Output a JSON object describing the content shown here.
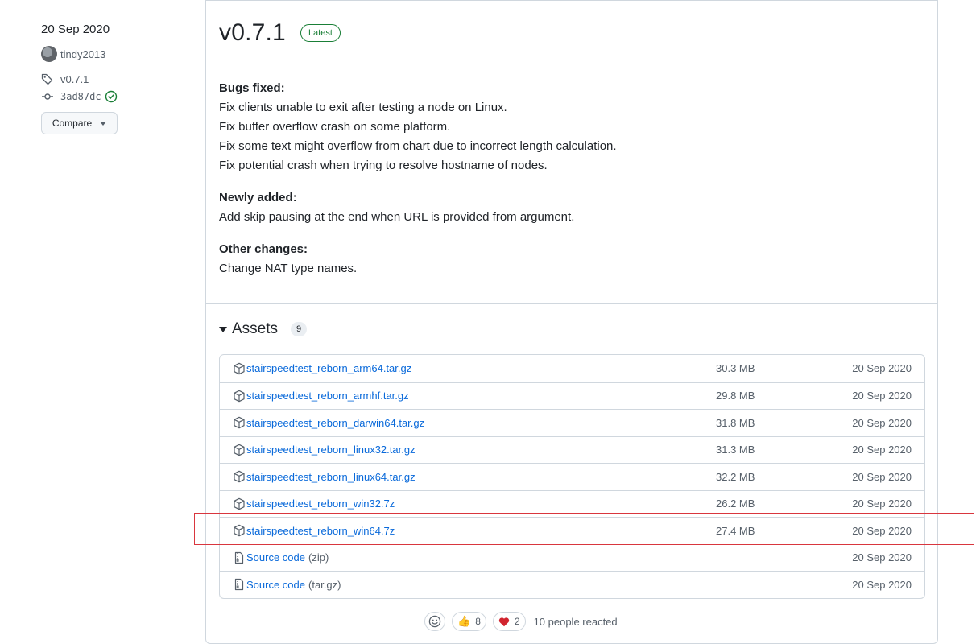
{
  "release_meta": {
    "date": "20 Sep 2020",
    "author": "tindy2013",
    "tag": "v0.7.1",
    "commit": "3ad87dc",
    "compare_label": "Compare"
  },
  "release": {
    "version": "v0.7.1",
    "badge": "Latest",
    "sections": [
      {
        "heading": "Bugs fixed:",
        "lines": [
          "Fix clients unable to exit after testing a node on Linux.",
          "Fix buffer overflow crash on some platform.",
          "Fix some text might overflow from chart due to incorrect length calculation.",
          "Fix potential crash when trying to resolve hostname of nodes."
        ]
      },
      {
        "heading": "Newly added:",
        "lines": [
          "Add skip pausing at the end when URL is provided from argument."
        ]
      },
      {
        "heading": "Other changes:",
        "lines": [
          "Change NAT type names."
        ]
      }
    ]
  },
  "assets": {
    "title": "Assets",
    "count": "9",
    "items": [
      {
        "name": "stairspeedtest_reborn_arm64.tar.gz",
        "sub": "",
        "size": "30.3 MB",
        "date": "20 Sep 2020",
        "icon": "package-icon"
      },
      {
        "name": "stairspeedtest_reborn_armhf.tar.gz",
        "sub": "",
        "size": "29.8 MB",
        "date": "20 Sep 2020",
        "icon": "package-icon"
      },
      {
        "name": "stairspeedtest_reborn_darwin64.tar.gz",
        "sub": "",
        "size": "31.8 MB",
        "date": "20 Sep 2020",
        "icon": "package-icon"
      },
      {
        "name": "stairspeedtest_reborn_linux32.tar.gz",
        "sub": "",
        "size": "31.3 MB",
        "date": "20 Sep 2020",
        "icon": "package-icon"
      },
      {
        "name": "stairspeedtest_reborn_linux64.tar.gz",
        "sub": "",
        "size": "32.2 MB",
        "date": "20 Sep 2020",
        "icon": "package-icon"
      },
      {
        "name": "stairspeedtest_reborn_win32.7z",
        "sub": "",
        "size": "26.2 MB",
        "date": "20 Sep 2020",
        "icon": "package-icon"
      },
      {
        "name": "stairspeedtest_reborn_win64.7z",
        "sub": "",
        "size": "27.4 MB",
        "date": "20 Sep 2020",
        "icon": "package-icon"
      },
      {
        "name": "Source code",
        "sub": "(zip)",
        "size": "",
        "date": "20 Sep 2020",
        "icon": "file-zip-icon"
      },
      {
        "name": "Source code",
        "sub": "(tar.gz)",
        "size": "",
        "date": "20 Sep 2020",
        "icon": "file-zip-icon"
      }
    ]
  },
  "reactions": {
    "thumbs_up_count": "8",
    "heart_count": "2",
    "summary": "10 people reacted"
  },
  "colors": {
    "link": "#0969da",
    "latest_green": "#1a7f37",
    "highlight_red": "#d9363e"
  }
}
